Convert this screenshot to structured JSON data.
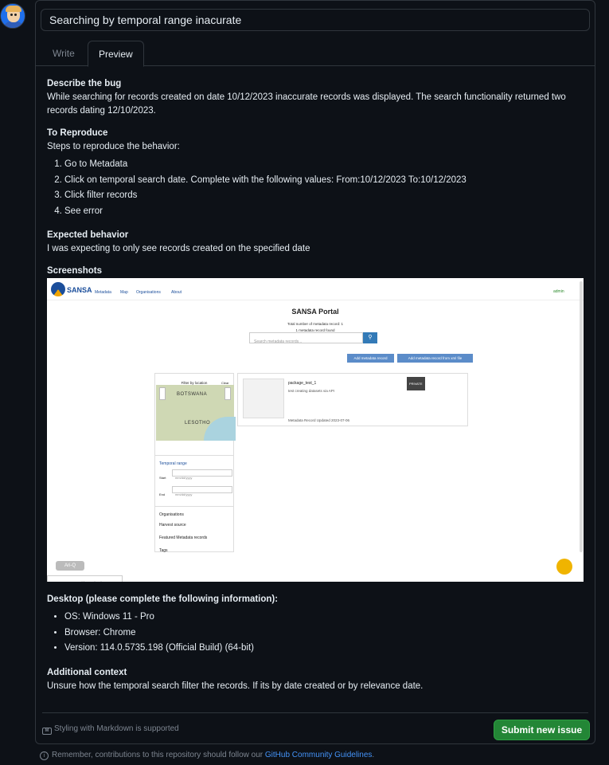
{
  "issue": {
    "title_value": "Searching by temporal range inacurate",
    "tabs": [
      "Write",
      "Preview"
    ]
  },
  "body": {
    "describe_heading": "Describe the bug",
    "describe_text": "While searching for records created on date 10/12/2023 inaccurate records was displayed. The search functionality returned two records dating 12/10/2023.",
    "reproduce_heading": "To Reproduce",
    "reproduce_intro": "Steps to reproduce the behavior:",
    "steps": [
      "Go to Metadata",
      "Click on temporal search date. Complete with the following values: From:10/12/2023 To:10/12/2023",
      "Click filter records",
      "See error"
    ],
    "expected_heading": "Expected behavior",
    "expected_text": "I was expecting to only see records created on the specified date",
    "screenshots_heading": "Screenshots",
    "desktop_heading": "Desktop (please complete the following information):",
    "desktop_items": [
      "OS: Windows 11 - Pro",
      "Browser: Chrome",
      "Version: 114.0.5735.198 (Official Build) (64-bit)"
    ],
    "context_heading": "Additional context",
    "context_text": "Unsure how the temporal search filter the records. If its by date created or by relevance date."
  },
  "screenshot": {
    "logo_text": "SANSA",
    "nav": [
      "Metadata",
      "Map",
      "Organisations",
      "About"
    ],
    "admin": "admin",
    "title": "SANSA Portal",
    "total": "Total number of metadata record: 1",
    "found": "1 metadata record found",
    "search_placeholder": "Search metadata records...",
    "btn_add": "Add metadata record",
    "btn_add_xml": "Add metadata record from xml file",
    "filter_location": "Filter by location",
    "clear": "Clear",
    "map_botswana": "BOTSWANA",
    "map_lesotho": "LESOTHO",
    "temporal_range": "Temporal range",
    "start": "Start",
    "end": "End",
    "date_placeholder": "mm/dd/yyyy",
    "organisations": "Organisations",
    "harvest": "Harvest source",
    "featured": "Featured Metadata records",
    "tags": "Tags",
    "record_title": "package_test_1",
    "record_desc": "test creating datasets via API",
    "record_updated": "Metadata Record Updated 2023-07-06",
    "private": "PRIVATE",
    "url": "10.150.16.179:5000/dataset/package_test_1",
    "aria": "Ari-Q"
  },
  "footer": {
    "markdown_note": "Styling with Markdown is supported",
    "submit": "Submit new issue",
    "guidelines_prefix": "Remember, contributions to this repository should follow our ",
    "guidelines_link": "GitHub Community Guidelines",
    "guidelines_suffix": "."
  },
  "colors": {
    "background": "#0d1117",
    "border": "#30363d",
    "submit_green": "#238636",
    "link_blue": "#4493f8"
  },
  "icons": [
    "avatar",
    "markdown-icon",
    "info-icon",
    "search-icon"
  ]
}
